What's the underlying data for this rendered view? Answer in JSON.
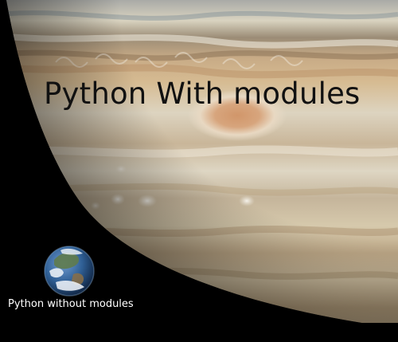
{
  "image": {
    "big_caption": "Python With modules",
    "small_caption": "Python without modules",
    "big_body_icon": "jupiter-icon",
    "small_body_icon": "earth-icon",
    "colors": {
      "background": "#000000",
      "jupiter_base": "#d8c8a8",
      "great_red_spot": "#d49a68",
      "earth_ocean": "#2f5f95",
      "big_caption_text": "#111111",
      "small_caption_text": "#ffffff"
    }
  }
}
